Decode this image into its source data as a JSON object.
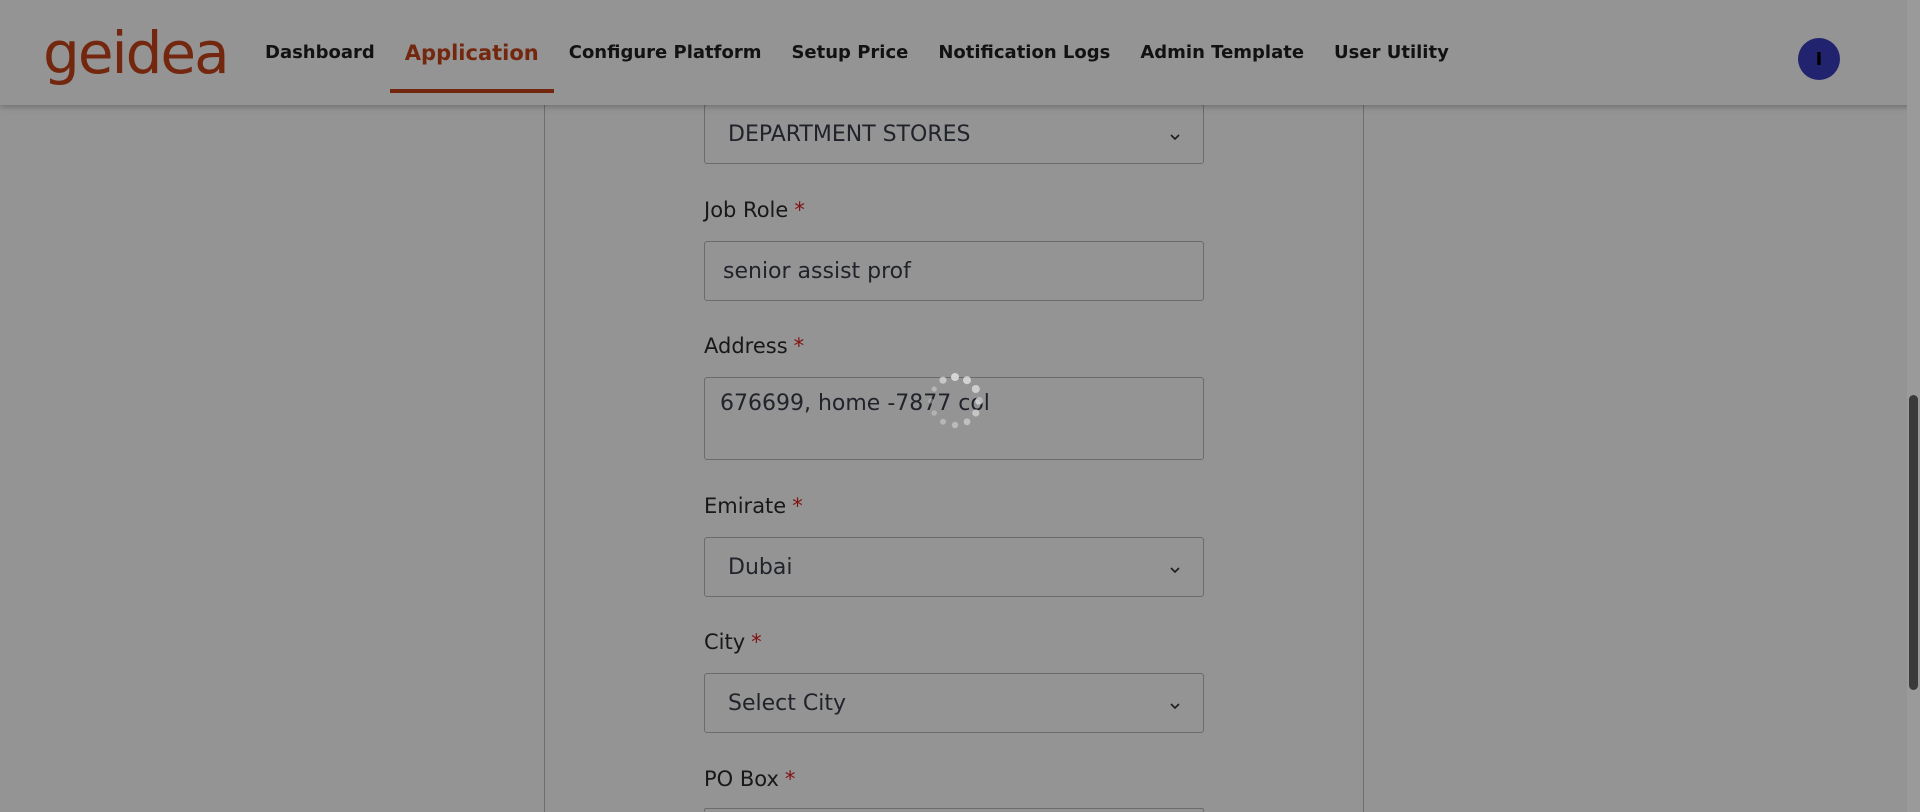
{
  "header": {
    "logo_text": "geidea",
    "nav": [
      {
        "label": "Dashboard"
      },
      {
        "label": "Application"
      },
      {
        "label": "Configure Platform"
      },
      {
        "label": "Setup Price"
      },
      {
        "label": "Notification Logs"
      },
      {
        "label": "Admin Template"
      },
      {
        "label": "User Utility"
      }
    ],
    "active_nav": "Application",
    "avatar_initial": "I"
  },
  "form": {
    "industry_select_value": "DEPARTMENT STORES",
    "job_role": {
      "label": "Job Role",
      "required_mark": "*",
      "value": "senior assist prof"
    },
    "address": {
      "label": "Address",
      "required_mark": "*",
      "value": "676699, home -7877 col"
    },
    "emirate": {
      "label": "Emirate",
      "required_mark": "*",
      "value": "Dubai"
    },
    "city": {
      "label": "City",
      "required_mark": "*",
      "value": "Select City"
    },
    "po_box": {
      "label": "PO Box",
      "required_mark": "*"
    }
  },
  "loading": true,
  "colors": {
    "brand": "#c8441b",
    "avatar": "#3a3dbd",
    "required": "#e02020"
  },
  "icons": {
    "dropdown": "chevron-down-icon",
    "loading": "spinner-icon"
  }
}
